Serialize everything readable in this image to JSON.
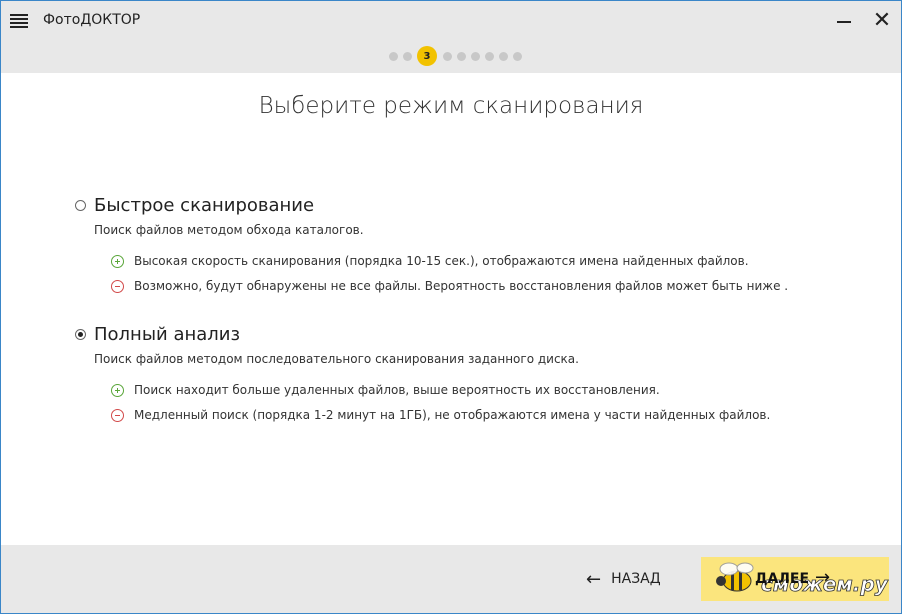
{
  "app": {
    "title": "ФотоДОКТОР"
  },
  "titlebar": {
    "minimize_icon": "minimize-icon",
    "close_icon": "close-icon",
    "menu_icon": "hamburger-menu-icon"
  },
  "steps": {
    "current_label": "3",
    "total": 9,
    "current": 3,
    "active_color": "#f2c200"
  },
  "main": {
    "heading": "Выберите режим сканирования",
    "options": [
      {
        "title": "Быстрое сканирование",
        "description": "Поиск файлов методом обхода каталогов.",
        "selected": false,
        "pros": [
          "Высокая скорость сканирования (порядка 10-15 сек.),  отображаются имена найденных  файлов."
        ],
        "cons": [
          "Возможно, будут обнаружены не все файлы. Вероятность восстановления файлов может быть ниже ."
        ]
      },
      {
        "title": "Полный анализ",
        "description": "Поиск файлов методом последовательного сканирования заданного диска.",
        "selected": true,
        "pros": [
          "Поиск находит больше удаленных файлов,  выше вероятность их восстановления."
        ],
        "cons": [
          "Медленный поиск  (порядка 1-2 минут на 1ГБ), не отображаются имена у части найденных файлов."
        ]
      }
    ]
  },
  "footer": {
    "back_label": "НАЗАД",
    "next_label": "ДАЛЕЕ",
    "watermark": "сможем.ру",
    "next_color": "#fbe57d"
  }
}
